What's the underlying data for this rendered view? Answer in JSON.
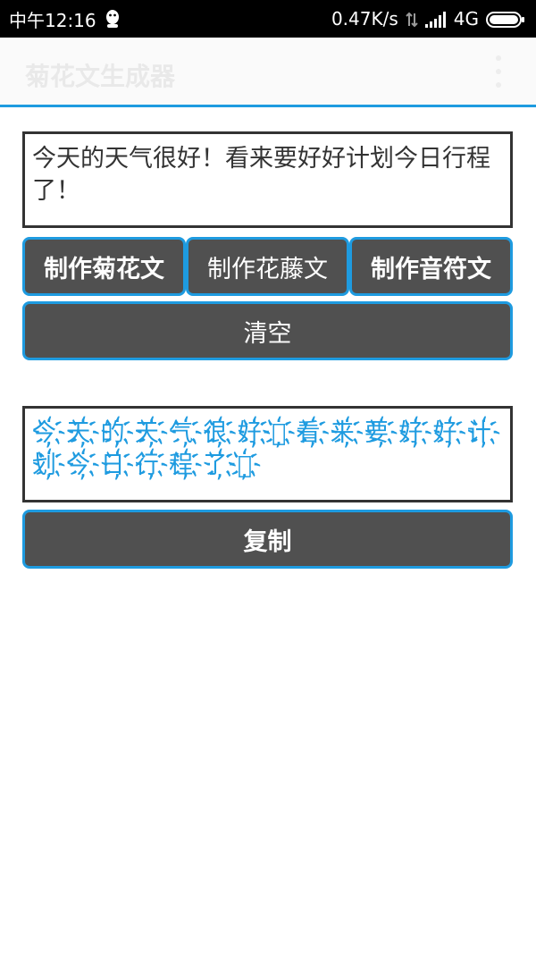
{
  "status_bar": {
    "time": "中午12:16",
    "net_speed": "0.47K/s",
    "network_type": "4G",
    "icons": [
      "qq-icon",
      "data-transfer-icon",
      "signal-icon",
      "battery-icon"
    ]
  },
  "app_bar": {
    "title": "菊花文生成器",
    "menu_icon": "overflow-menu-icon"
  },
  "input": {
    "value": "今天的天气很好！看来要好好计划今日行程了！"
  },
  "buttons": {
    "chrysanthemum": "制作菊花文",
    "vine": "制作花藤文",
    "note": "制作音符文",
    "clear": "清空",
    "copy": "复制"
  },
  "output": {
    "value": "今҉天҉的҉天҉气҉很҉好҉！҉看҉来҉要҉好҉好҉计҉划҉今҉日҉行҉程҉了҉！҉"
  },
  "colors": {
    "accent": "#1e9be0",
    "button_bg": "#505050",
    "status_bar_bg": "#000000"
  }
}
